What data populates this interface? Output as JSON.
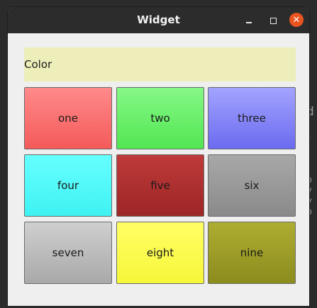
{
  "window": {
    "title": "Widget"
  },
  "label": {
    "text": "Color",
    "background": "#eeeebb"
  },
  "buttons": [
    {
      "label": "one",
      "top": "#ff8a8a",
      "bottom": "#f45a5a"
    },
    {
      "label": "two",
      "top": "#86f886",
      "bottom": "#52e652"
    },
    {
      "label": "three",
      "top": "#a3a3ff",
      "bottom": "#6b6bf0"
    },
    {
      "label": "four",
      "top": "#66ffff",
      "bottom": "#3ff2f2"
    },
    {
      "label": "five",
      "top": "#c03a3a",
      "bottom": "#9c2626"
    },
    {
      "label": "six",
      "top": "#a8a8a8",
      "bottom": "#8a8a8a"
    },
    {
      "label": "seven",
      "top": "#cfcfcf",
      "bottom": "#a9a9a9"
    },
    {
      "label": "eight",
      "top": "#ffff66",
      "bottom": "#f6f63a"
    },
    {
      "label": "nine",
      "top": "#adad32",
      "bottom": "#8c8c1e"
    }
  ],
  "background_fragments": [
    "d",
    "r",
    "o",
    "v",
    "v",
    "o"
  ]
}
